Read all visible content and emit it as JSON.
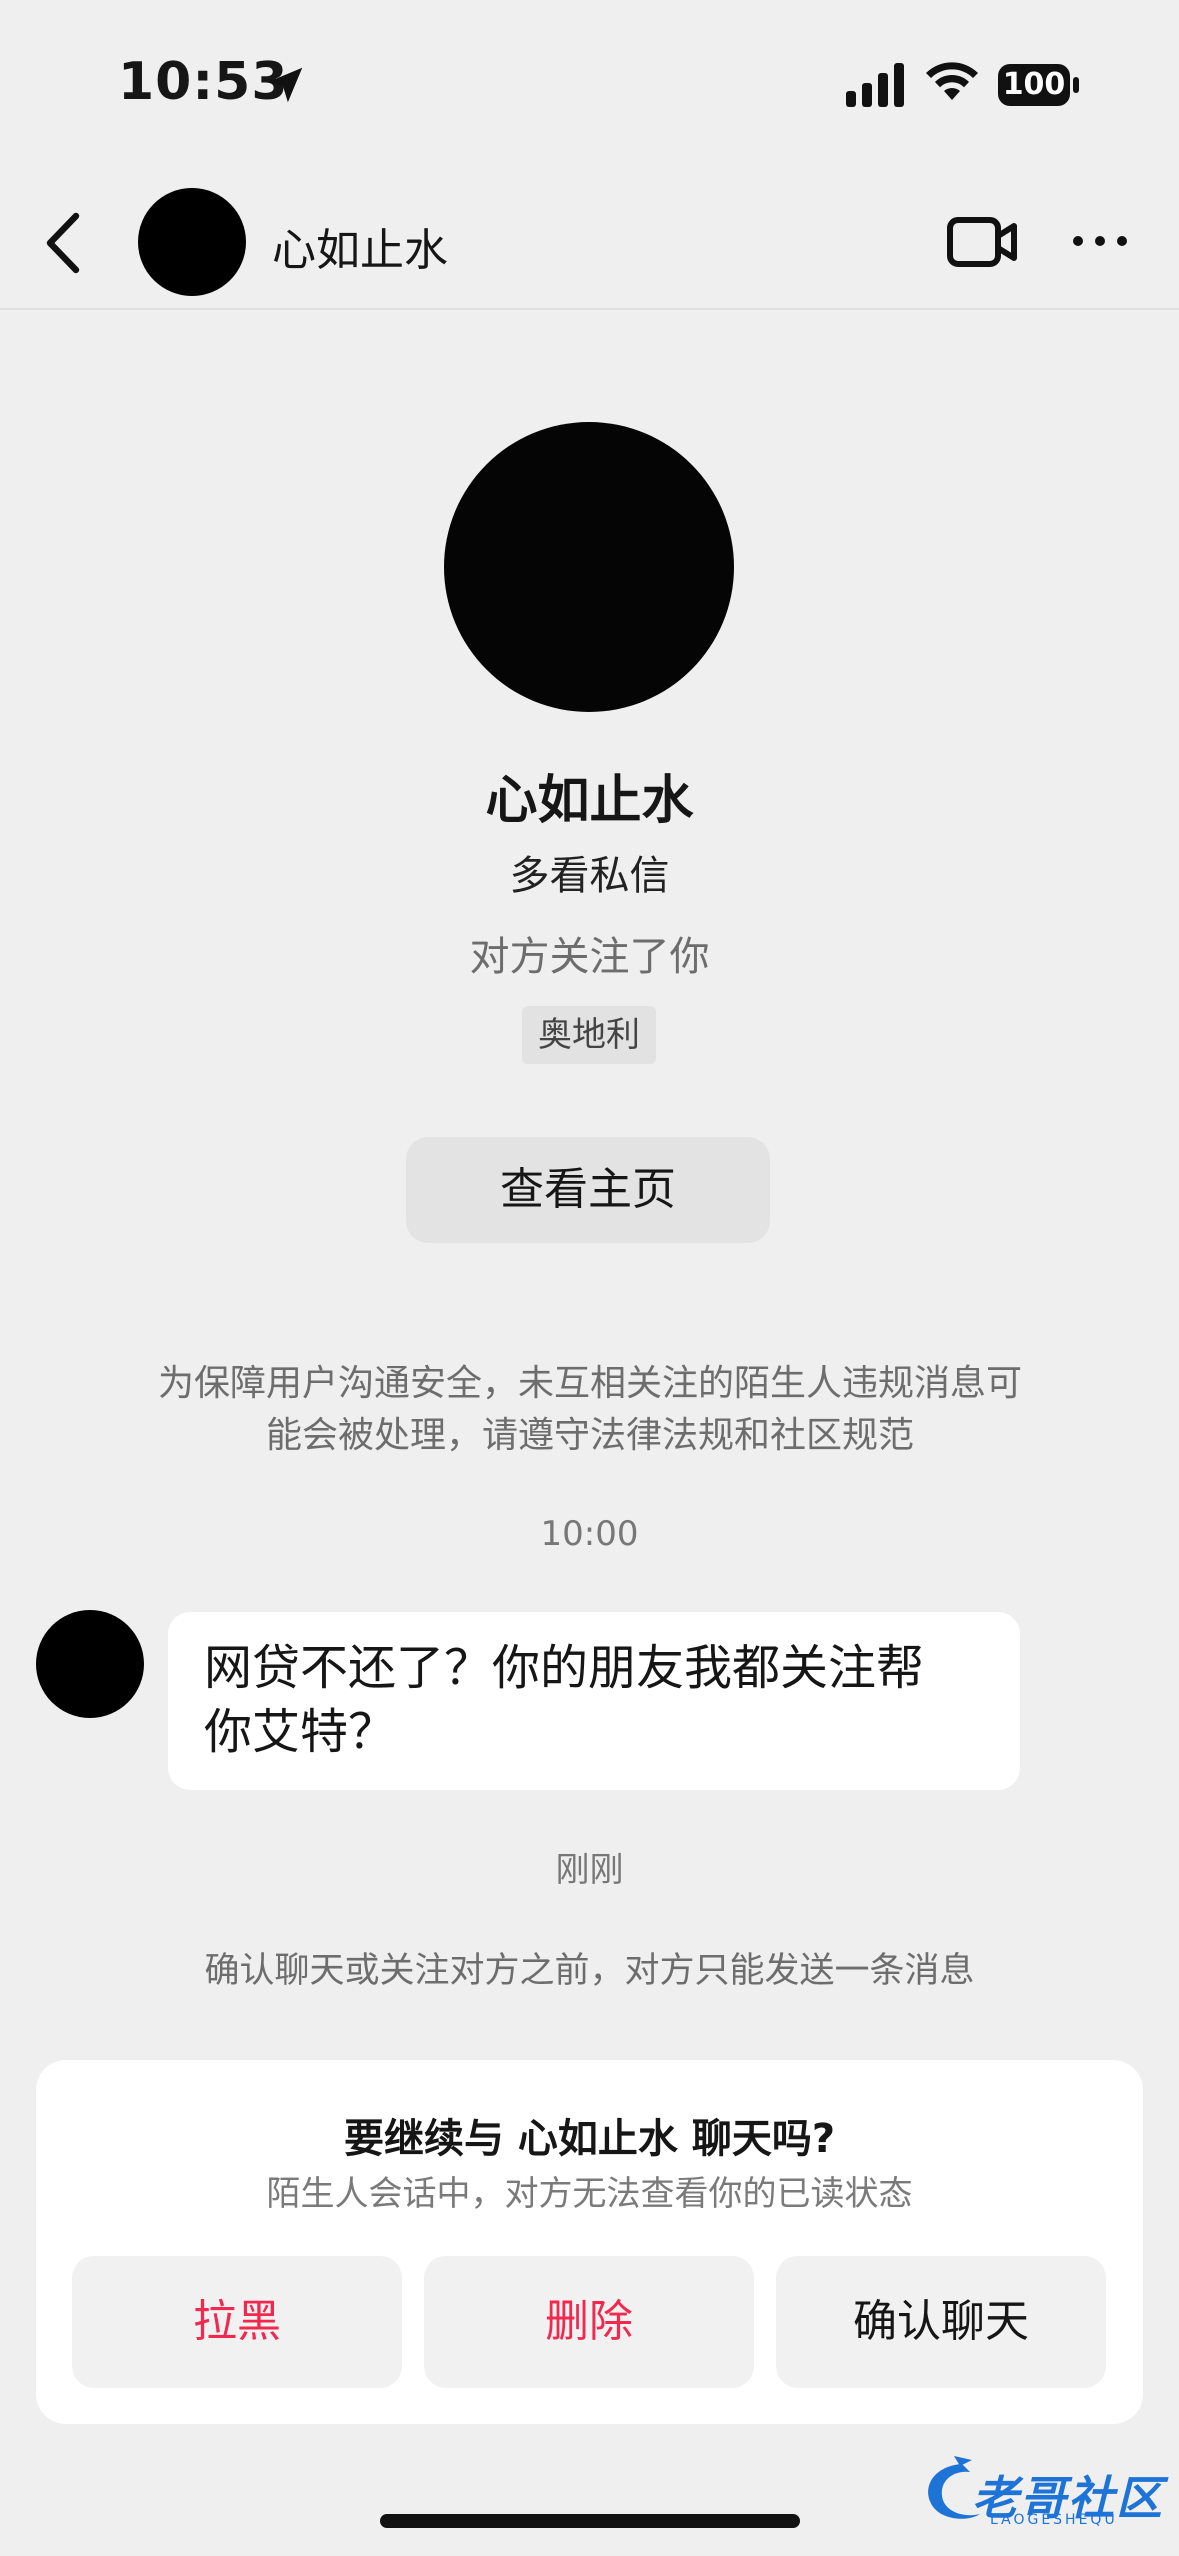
{
  "status_bar": {
    "time": "10:53",
    "battery": "100"
  },
  "nav": {
    "contact_name": "心如止水"
  },
  "profile": {
    "name": "心如止水",
    "bio": "多看私信",
    "follow_status": "对方关注了你",
    "location": "奥地利",
    "view_home_label": "查看主页"
  },
  "chat": {
    "safety_notice_line1": "为保障用户沟通安全，未互相关注的陌生人违规消息可",
    "safety_notice_line2": "能会被处理，请遵守法律法规和社区规范",
    "timestamp": "10:00",
    "message_line1": "网贷不还了？你的朋友我都关注帮",
    "message_line2": "你艾特？",
    "just_now": "刚刚",
    "limit_note": "确认聊天或关注对方之前，对方只能发送一条消息"
  },
  "prompt_card": {
    "title": "要继续与 心如止水 聊天吗?",
    "subtitle": "陌生人会话中，对方无法查看你的已读状态",
    "block_label": "拉黑",
    "delete_label": "删除",
    "confirm_label": "确认聊天"
  },
  "watermark": {
    "text": "老哥社区",
    "sub": "LAOGESHEQU"
  },
  "colors": {
    "background": "#efefef",
    "danger": "#f1294f",
    "watermark": "#1e74d6"
  },
  "icons": [
    "location-arrow-icon",
    "cellular-signal-icon",
    "wifi-icon",
    "battery-icon",
    "back-chevron-icon",
    "video-call-icon",
    "more-dots-icon"
  ]
}
